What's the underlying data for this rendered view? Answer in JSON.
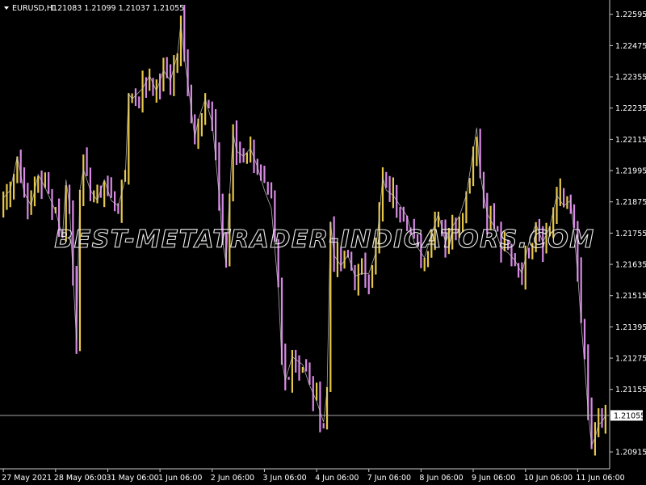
{
  "header": {
    "symbol_label": "EURUSD,H1",
    "ohlc_text": "1.21083 1.21099 1.21037 1.21055"
  },
  "watermark": "BEST-METATRADER-INDICATORS.COM",
  "colors": {
    "background": "#000000",
    "bull_candle": "#e6c84a",
    "bear_candle": "#d88ae6",
    "zigzag": "#c8c8c8",
    "axis": "#c8c8c8",
    "text": "#ffffff"
  },
  "chart_data": {
    "type": "line",
    "symbol": "EURUSD",
    "timeframe": "H1",
    "ylim": [
      1.2085,
      1.2265
    ],
    "y_ticks": [
      1.22595,
      1.22475,
      1.22355,
      1.22235,
      1.22115,
      1.21995,
      1.21875,
      1.21755,
      1.21635,
      1.21515,
      1.21395,
      1.21275,
      1.21155,
      1.20915
    ],
    "x_tick_labels": [
      "27 May 2021",
      "28 May 06:00",
      "31 May 06:00",
      "1 Jun 06:00",
      "2 Jun 06:00",
      "3 Jun 06:00",
      "4 Jun 06:00",
      "7 Jun 06:00",
      "8 Jun 06:00",
      "9 Jun 06:00",
      "10 Jun 06:00",
      "11 Jun 06:00"
    ],
    "x_ticks_index": [
      0,
      15,
      30,
      45,
      60,
      75,
      90,
      105,
      120,
      135,
      150,
      165
    ],
    "n_bars": 174,
    "current_price": 1.21055,
    "close_series_keypoints": [
      [
        0,
        1.2189
      ],
      [
        2,
        1.2192
      ],
      [
        4,
        1.2205
      ],
      [
        6,
        1.2191
      ],
      [
        8,
        1.2186
      ],
      [
        10,
        1.2198
      ],
      [
        12,
        1.2193
      ],
      [
        15,
        1.2184
      ],
      [
        17,
        1.2174
      ],
      [
        18,
        1.2196
      ],
      [
        19,
        1.2186
      ],
      [
        20,
        1.216
      ],
      [
        21,
        1.2134
      ],
      [
        22,
        1.2192
      ],
      [
        23,
        1.22
      ],
      [
        25,
        1.2192
      ],
      [
        27,
        1.2188
      ],
      [
        29,
        1.2196
      ],
      [
        31,
        1.2188
      ],
      [
        33,
        1.2186
      ],
      [
        35,
        1.2196
      ],
      [
        36,
        1.2229
      ],
      [
        37,
        1.2227
      ],
      [
        40,
        1.2231
      ],
      [
        42,
        1.2236
      ],
      [
        44,
        1.223
      ],
      [
        46,
        1.2238
      ],
      [
        48,
        1.2234
      ],
      [
        50,
        1.2244
      ],
      [
        51,
        1.2256
      ],
      [
        52,
        1.2243
      ],
      [
        54,
        1.2223
      ],
      [
        55,
        1.2212
      ],
      [
        56,
        1.2219
      ],
      [
        58,
        1.2227
      ],
      [
        60,
        1.2218
      ],
      [
        62,
        1.219
      ],
      [
        63,
        1.2172
      ],
      [
        64,
        1.2164
      ],
      [
        65,
        1.219
      ],
      [
        66,
        1.2214
      ],
      [
        67,
        1.2207
      ],
      [
        69,
        1.2205
      ],
      [
        71,
        1.2208
      ],
      [
        73,
        1.2201
      ],
      [
        75,
        1.2192
      ],
      [
        77,
        1.2185
      ],
      [
        79,
        1.2154
      ],
      [
        80,
        1.2127
      ],
      [
        81,
        1.2119
      ],
      [
        83,
        1.2128
      ],
      [
        86,
        1.2125
      ],
      [
        88,
        1.2117
      ],
      [
        90,
        1.2111
      ],
      [
        92,
        1.2103
      ],
      [
        93,
        1.2115
      ],
      [
        94,
        1.218
      ],
      [
        95,
        1.2167
      ],
      [
        97,
        1.2163
      ],
      [
        99,
        1.2167
      ],
      [
        101,
        1.2159
      ],
      [
        103,
        1.216
      ],
      [
        105,
        1.216
      ],
      [
        107,
        1.2168
      ],
      [
        109,
        1.2197
      ],
      [
        110,
        1.2192
      ],
      [
        112,
        1.219
      ],
      [
        114,
        1.2186
      ],
      [
        116,
        1.2182
      ],
      [
        118,
        1.2172
      ],
      [
        120,
        1.2168
      ],
      [
        121,
        1.2166
      ],
      [
        123,
        1.2175
      ],
      [
        125,
        1.2183
      ],
      [
        127,
        1.2172
      ],
      [
        129,
        1.2178
      ],
      [
        131,
        1.2182
      ],
      [
        133,
        1.219
      ],
      [
        135,
        1.2207
      ],
      [
        136,
        1.2216
      ],
      [
        137,
        1.2198
      ],
      [
        139,
        1.2183
      ],
      [
        141,
        1.2178
      ],
      [
        143,
        1.217
      ],
      [
        145,
        1.2168
      ],
      [
        147,
        1.2165
      ],
      [
        149,
        1.216
      ],
      [
        151,
        1.2172
      ],
      [
        153,
        1.2179
      ],
      [
        155,
        1.2172
      ],
      [
        157,
        1.2178
      ],
      [
        159,
        1.219
      ],
      [
        161,
        1.2186
      ],
      [
        163,
        1.2188
      ],
      [
        164,
        1.2175
      ],
      [
        165,
        1.216
      ],
      [
        166,
        1.2141
      ],
      [
        167,
        1.2125
      ],
      [
        168,
        1.2107
      ],
      [
        169,
        1.2094
      ],
      [
        170,
        1.2097
      ],
      [
        171,
        1.2102
      ],
      [
        172,
        1.2103
      ],
      [
        173,
        1.21055
      ]
    ]
  }
}
